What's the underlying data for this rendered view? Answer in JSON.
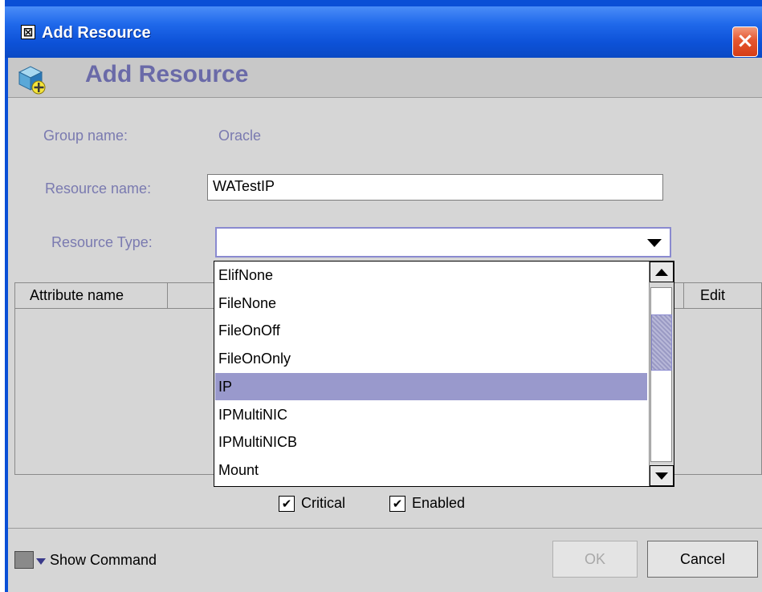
{
  "window": {
    "title": "Add Resource",
    "close_label": "×"
  },
  "header": {
    "title": "Add Resource",
    "icon": "cube-add-icon"
  },
  "form": {
    "group_label": "Group name:",
    "group_value": "Oracle",
    "resource_name_label": "Resource name:",
    "resource_name_value": "WATestIP",
    "resource_type_label": "Resource Type:",
    "resource_type_value": ""
  },
  "table": {
    "columns": [
      "Attribute name",
      "Edit"
    ]
  },
  "dropdown": {
    "items": [
      "ElifNone",
      "FileNone",
      "FileOnOff",
      "FileOnOnly",
      "IP",
      "IPMultiNIC",
      "IPMultiNICB",
      "Mount"
    ],
    "selected": "IP"
  },
  "checkboxes": [
    {
      "label": "Critical",
      "checked": true
    },
    {
      "label": "Enabled",
      "checked": true
    }
  ],
  "footer": {
    "show_command_label": "Show Command",
    "ok_label": "OK",
    "cancel_label": "Cancel"
  },
  "colors": {
    "title_bar": "#1f68ea",
    "selection": "#9999cc",
    "label_text": "#7a7ab0"
  }
}
